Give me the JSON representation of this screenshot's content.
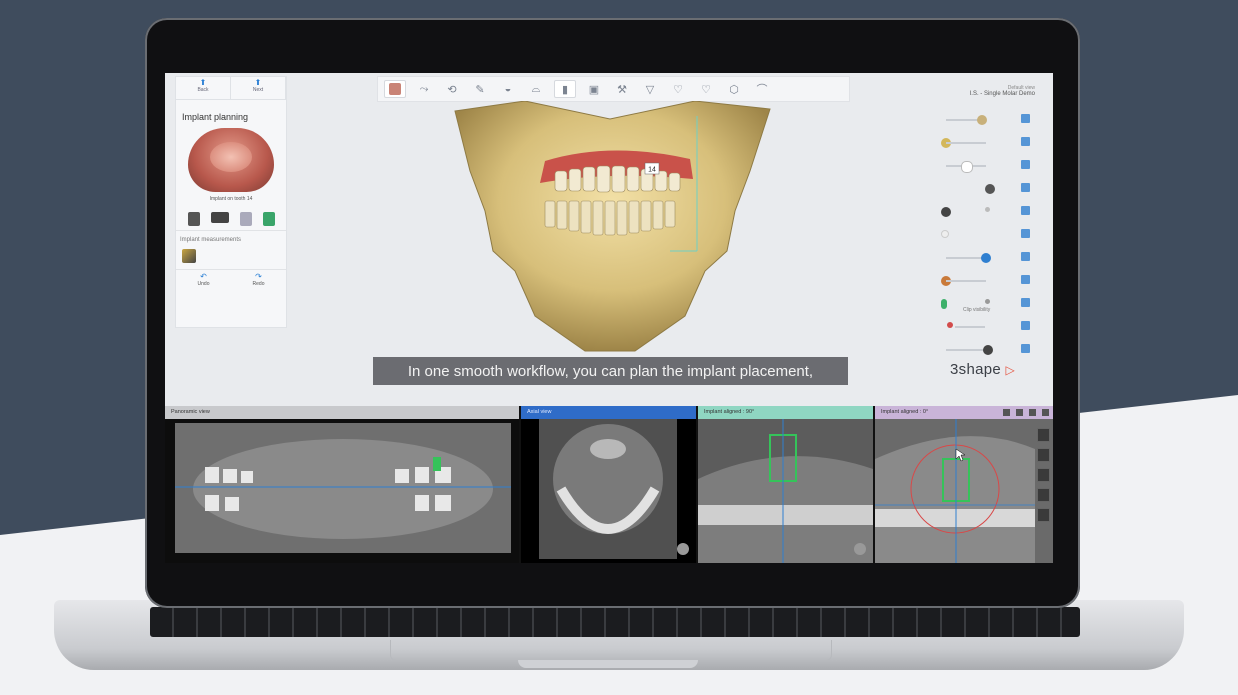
{
  "left_panel": {
    "back_label": "Back",
    "next_label": "Next",
    "title": "Implant planning",
    "model_caption": "Implant on tooth 14",
    "measurements_label": "Implant measurements",
    "undo_label": "Undo",
    "redo_label": "Redo"
  },
  "toolbar": {
    "tools": [
      "tool-1",
      "tool-2",
      "tool-3",
      "tool-4",
      "tool-5",
      "tool-6",
      "tool-7",
      "tool-8",
      "tool-9",
      "tool-10",
      "tool-11",
      "tool-12",
      "tool-13",
      "tool-14"
    ]
  },
  "view": {
    "label": "Default view",
    "case_name": "I.S. - Single Molar Demo"
  },
  "tooth_marker": "14",
  "clip_label": "Clip visibility",
  "subtitle": "In one smooth workflow, you can plan the implant placement,",
  "logo": {
    "text": "3shape",
    "mark": "▷"
  },
  "panes": {
    "panoramic": {
      "title": "Panoramic view",
      "header_color": "#c8c9cc"
    },
    "axial": {
      "title": "Axial view",
      "header_color": "#2f6cc8"
    },
    "aligned90": {
      "title": "Implant aligned : 90°",
      "header_color": "#8fd6c2"
    },
    "aligned0": {
      "title": "Implant aligned : 0°",
      "header_color": "#c9b4d8"
    }
  },
  "colors": {
    "bone": "#d7bf7a",
    "gum": "#c9524a",
    "accent": "#2a7fd4",
    "implant": "#35c35a"
  }
}
